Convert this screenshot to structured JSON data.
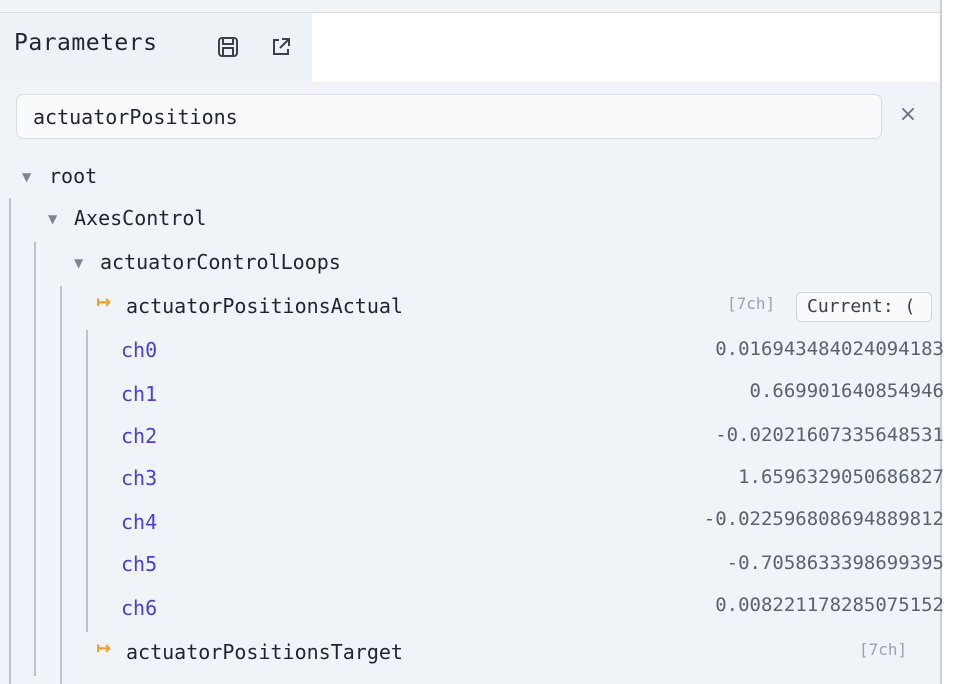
{
  "panel": {
    "title": "Parameters"
  },
  "icons": {
    "save": "save-icon",
    "open_external": "external-link-icon",
    "clear": "close-icon"
  },
  "search": {
    "value": "actuatorPositions",
    "clear_label": "×"
  },
  "tree": {
    "root": {
      "label": "root",
      "expand_icon": "▼"
    },
    "axes": {
      "label": "AxesControl",
      "expand_icon": "▼"
    },
    "loops": {
      "label": "actuatorControlLoops",
      "expand_icon": "▼"
    },
    "actual": {
      "icon": "↦",
      "label": "actuatorPositionsActual",
      "tag": "[7ch]",
      "current_label": "Current: ("
    },
    "channels": [
      {
        "label": "ch0",
        "value": "0.016943484024094183"
      },
      {
        "label": "ch1",
        "value": "0.669901640854946"
      },
      {
        "label": "ch2",
        "value": "-0.02021607335648531"
      },
      {
        "label": "ch3",
        "value": "1.6596329050686827"
      },
      {
        "label": "ch4",
        "value": "-0.022596808694889812"
      },
      {
        "label": "ch5",
        "value": "-0.7058633398699395"
      },
      {
        "label": "ch6",
        "value": "0.008221178285075152"
      }
    ],
    "target": {
      "icon": "↦",
      "label": "actuatorPositionsTarget",
      "tag": "[7ch]"
    }
  },
  "colors": {
    "channel": "#4a3fd0",
    "arrow": "#f0a020",
    "value": "#5a6270"
  }
}
